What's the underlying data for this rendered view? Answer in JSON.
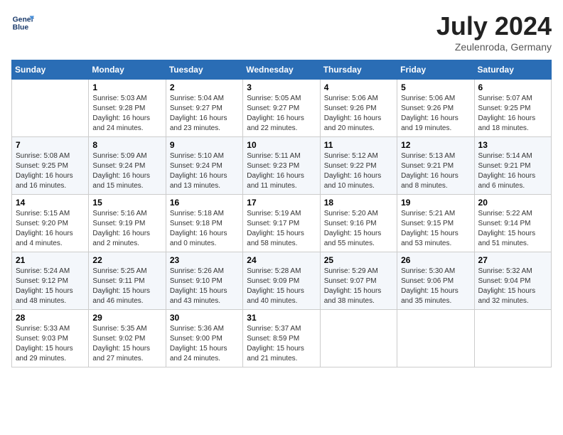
{
  "header": {
    "logo_line1": "General",
    "logo_line2": "Blue",
    "month_title": "July 2024",
    "subtitle": "Zeulenroda, Germany"
  },
  "weekdays": [
    "Sunday",
    "Monday",
    "Tuesday",
    "Wednesday",
    "Thursday",
    "Friday",
    "Saturday"
  ],
  "weeks": [
    [
      {
        "day": "",
        "empty": true
      },
      {
        "day": "1",
        "sunrise": "5:03 AM",
        "sunset": "9:28 PM",
        "daylight": "16 hours and 24 minutes."
      },
      {
        "day": "2",
        "sunrise": "5:04 AM",
        "sunset": "9:27 PM",
        "daylight": "16 hours and 23 minutes."
      },
      {
        "day": "3",
        "sunrise": "5:05 AM",
        "sunset": "9:27 PM",
        "daylight": "16 hours and 22 minutes."
      },
      {
        "day": "4",
        "sunrise": "5:06 AM",
        "sunset": "9:26 PM",
        "daylight": "16 hours and 20 minutes."
      },
      {
        "day": "5",
        "sunrise": "5:06 AM",
        "sunset": "9:26 PM",
        "daylight": "16 hours and 19 minutes."
      },
      {
        "day": "6",
        "sunrise": "5:07 AM",
        "sunset": "9:25 PM",
        "daylight": "16 hours and 18 minutes."
      }
    ],
    [
      {
        "day": "7",
        "sunrise": "5:08 AM",
        "sunset": "9:25 PM",
        "daylight": "16 hours and 16 minutes."
      },
      {
        "day": "8",
        "sunrise": "5:09 AM",
        "sunset": "9:24 PM",
        "daylight": "16 hours and 15 minutes."
      },
      {
        "day": "9",
        "sunrise": "5:10 AM",
        "sunset": "9:24 PM",
        "daylight": "16 hours and 13 minutes."
      },
      {
        "day": "10",
        "sunrise": "5:11 AM",
        "sunset": "9:23 PM",
        "daylight": "16 hours and 11 minutes."
      },
      {
        "day": "11",
        "sunrise": "5:12 AM",
        "sunset": "9:22 PM",
        "daylight": "16 hours and 10 minutes."
      },
      {
        "day": "12",
        "sunrise": "5:13 AM",
        "sunset": "9:21 PM",
        "daylight": "16 hours and 8 minutes."
      },
      {
        "day": "13",
        "sunrise": "5:14 AM",
        "sunset": "9:21 PM",
        "daylight": "16 hours and 6 minutes."
      }
    ],
    [
      {
        "day": "14",
        "sunrise": "5:15 AM",
        "sunset": "9:20 PM",
        "daylight": "16 hours and 4 minutes."
      },
      {
        "day": "15",
        "sunrise": "5:16 AM",
        "sunset": "9:19 PM",
        "daylight": "16 hours and 2 minutes."
      },
      {
        "day": "16",
        "sunrise": "5:18 AM",
        "sunset": "9:18 PM",
        "daylight": "16 hours and 0 minutes."
      },
      {
        "day": "17",
        "sunrise": "5:19 AM",
        "sunset": "9:17 PM",
        "daylight": "15 hours and 58 minutes."
      },
      {
        "day": "18",
        "sunrise": "5:20 AM",
        "sunset": "9:16 PM",
        "daylight": "15 hours and 55 minutes."
      },
      {
        "day": "19",
        "sunrise": "5:21 AM",
        "sunset": "9:15 PM",
        "daylight": "15 hours and 53 minutes."
      },
      {
        "day": "20",
        "sunrise": "5:22 AM",
        "sunset": "9:14 PM",
        "daylight": "15 hours and 51 minutes."
      }
    ],
    [
      {
        "day": "21",
        "sunrise": "5:24 AM",
        "sunset": "9:12 PM",
        "daylight": "15 hours and 48 minutes."
      },
      {
        "day": "22",
        "sunrise": "5:25 AM",
        "sunset": "9:11 PM",
        "daylight": "15 hours and 46 minutes."
      },
      {
        "day": "23",
        "sunrise": "5:26 AM",
        "sunset": "9:10 PM",
        "daylight": "15 hours and 43 minutes."
      },
      {
        "day": "24",
        "sunrise": "5:28 AM",
        "sunset": "9:09 PM",
        "daylight": "15 hours and 40 minutes."
      },
      {
        "day": "25",
        "sunrise": "5:29 AM",
        "sunset": "9:07 PM",
        "daylight": "15 hours and 38 minutes."
      },
      {
        "day": "26",
        "sunrise": "5:30 AM",
        "sunset": "9:06 PM",
        "daylight": "15 hours and 35 minutes."
      },
      {
        "day": "27",
        "sunrise": "5:32 AM",
        "sunset": "9:04 PM",
        "daylight": "15 hours and 32 minutes."
      }
    ],
    [
      {
        "day": "28",
        "sunrise": "5:33 AM",
        "sunset": "9:03 PM",
        "daylight": "15 hours and 29 minutes."
      },
      {
        "day": "29",
        "sunrise": "5:35 AM",
        "sunset": "9:02 PM",
        "daylight": "15 hours and 27 minutes."
      },
      {
        "day": "30",
        "sunrise": "5:36 AM",
        "sunset": "9:00 PM",
        "daylight": "15 hours and 24 minutes."
      },
      {
        "day": "31",
        "sunrise": "5:37 AM",
        "sunset": "8:59 PM",
        "daylight": "15 hours and 21 minutes."
      },
      {
        "day": "",
        "empty": true
      },
      {
        "day": "",
        "empty": true
      },
      {
        "day": "",
        "empty": true
      }
    ]
  ]
}
